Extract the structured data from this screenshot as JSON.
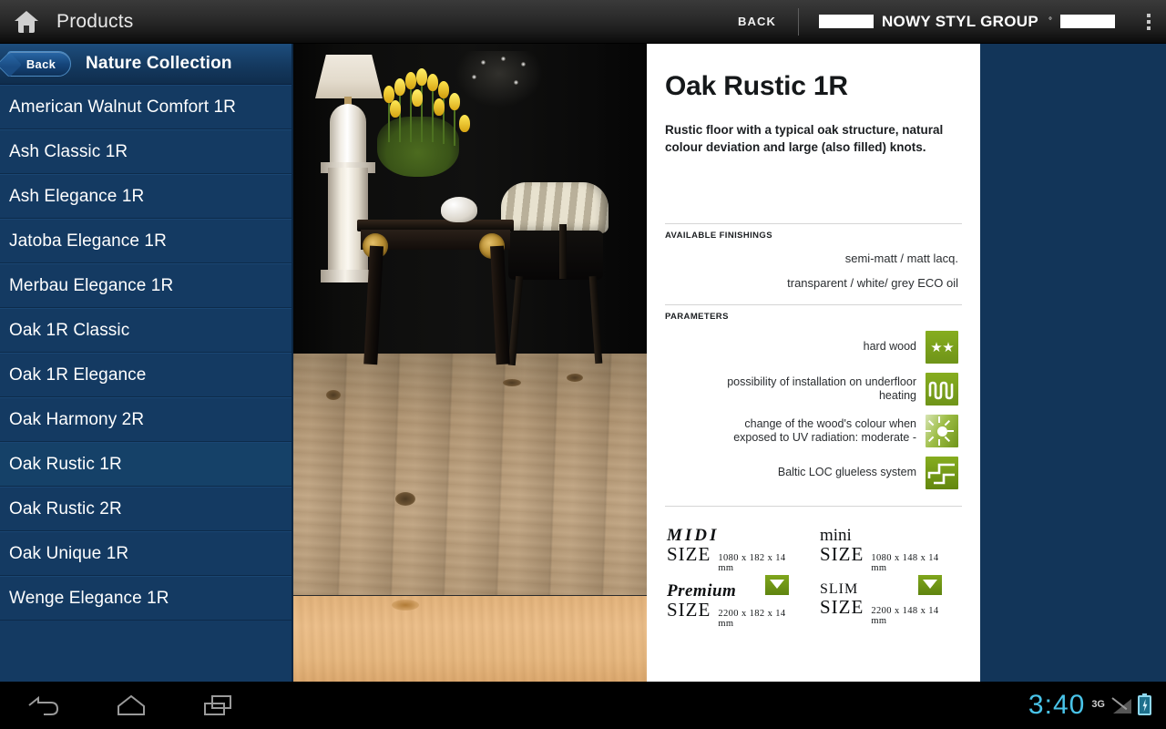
{
  "topbar": {
    "home_icon": "home-icon",
    "title": "Products",
    "back_label": "BACK",
    "brand_name": "NOWY STYL GROUP",
    "brand_tm": "°",
    "overflow_icon": "overflow-menu-icon"
  },
  "sidebar": {
    "back_button": "Back",
    "collection_title": "Nature Collection",
    "items": [
      {
        "label": "American Walnut Comfort 1R",
        "selected": false
      },
      {
        "label": "Ash Classic 1R",
        "selected": false
      },
      {
        "label": "Ash Elegance 1R",
        "selected": false
      },
      {
        "label": "Jatoba Elegance 1R",
        "selected": false
      },
      {
        "label": "Merbau Elegance 1R",
        "selected": false
      },
      {
        "label": "Oak 1R Classic",
        "selected": false
      },
      {
        "label": "Oak 1R Elegance",
        "selected": false
      },
      {
        "label": "Oak Harmony 2R",
        "selected": false
      },
      {
        "label": "Oak Rustic 1R",
        "selected": true
      },
      {
        "label": "Oak Rustic 2R",
        "selected": false
      },
      {
        "label": "Oak Unique 1R",
        "selected": false
      },
      {
        "label": "Wenge Elegance 1R",
        "selected": false
      }
    ]
  },
  "photo": {
    "alt": "interior-room-with-oak-floor",
    "sample_alt": "oak-wood-sample-strip"
  },
  "detail": {
    "title": "Oak Rustic 1R",
    "description": "Rustic floor with a typical oak structure, natural colour deviation and large (also filled) knots.",
    "finishings_label": "AVAILABLE FINISHINGS",
    "finishings": [
      "semi-matt / matt lacq.",
      "transparent / white/ grey ECO oil"
    ],
    "parameters_label": "PARAMETERS",
    "parameters": [
      {
        "text": "hard wood",
        "icon": "two-stars-icon"
      },
      {
        "text": "possibility of installation on underfloor heating",
        "icon": "underfloor-heating-icon"
      },
      {
        "text": "change of the wood's colour when exposed to UV radiation: moderate -",
        "icon": "uv-sun-icon"
      },
      {
        "text": "Baltic LOC glueless system",
        "icon": "baltic-loc-icon"
      }
    ],
    "sizes": [
      {
        "kind": "MIDI",
        "word": "SIZE",
        "dimensions": "1080 x 182 x 14 mm",
        "badge": false
      },
      {
        "kind": "mini",
        "word": "SIZE",
        "dimensions": "1080 x 148 x 14 mm",
        "badge": false
      },
      {
        "kind": "Premium",
        "word": "SIZE",
        "dimensions": "2200 x 182 x 14 mm",
        "badge": true
      },
      {
        "kind": "SLIM",
        "word": "SIZE",
        "dimensions": "2200 x 148 x 14 mm",
        "badge": true
      }
    ]
  },
  "systembar": {
    "back_icon": "back-arrow-icon",
    "home_icon": "home-nav-icon",
    "recents_icon": "recent-apps-icon",
    "clock": "3:40",
    "network": "3G",
    "signal_icon": "signal-icon",
    "battery_icon": "battery-charging-icon"
  },
  "colors": {
    "sidebar_blue": "#143a62",
    "accent_green": "#7fa61c",
    "clock_blue": "#49c3e8"
  }
}
